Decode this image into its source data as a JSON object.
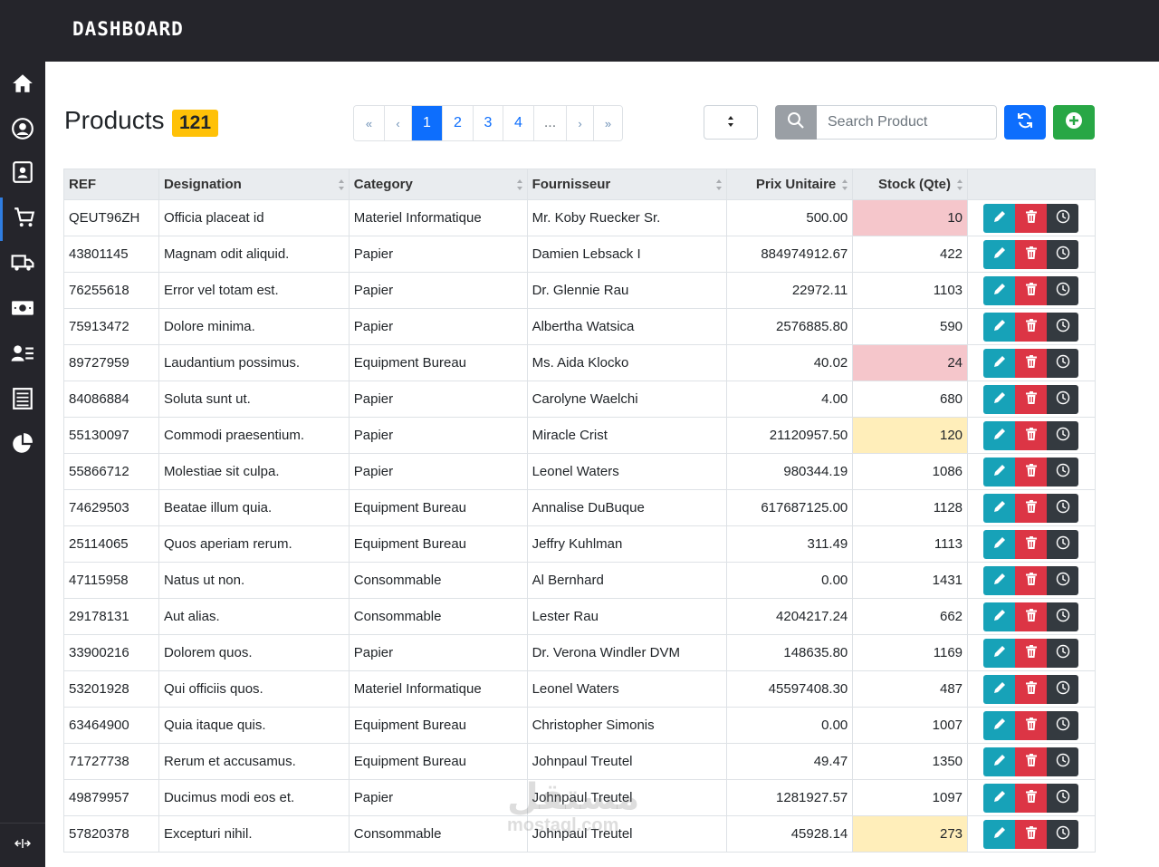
{
  "header": {
    "brand": "DASHBOARD"
  },
  "sidebar": {
    "items": [
      {
        "icon": "home-icon",
        "active": false
      },
      {
        "icon": "user-circle-icon",
        "active": false
      },
      {
        "icon": "contact-card-icon",
        "active": false
      },
      {
        "icon": "cart-icon",
        "active": true
      },
      {
        "icon": "truck-icon",
        "active": false
      },
      {
        "icon": "money-icon",
        "active": false
      },
      {
        "icon": "user-list-icon",
        "active": false
      },
      {
        "icon": "document-icon",
        "active": false
      },
      {
        "icon": "pie-chart-icon",
        "active": false
      }
    ],
    "collapse_icon": "collapse-icon"
  },
  "page": {
    "title": "Products",
    "count": "121"
  },
  "pagination": {
    "first": "«",
    "prev": "‹",
    "pages": [
      "1",
      "2",
      "3",
      "4"
    ],
    "active": "1",
    "ellipsis": "...",
    "next": "›",
    "last": "»"
  },
  "toolbar": {
    "search_placeholder": "Search Product",
    "search_icon": "search-icon",
    "refresh_icon": "refresh-icon",
    "add_icon": "plus-circle-icon"
  },
  "table": {
    "columns": [
      "REF",
      "Designation",
      "Category",
      "Fournisseur",
      "Prix Unitaire",
      "Stock (Qte)"
    ],
    "rows": [
      {
        "ref": "QEUT96ZH",
        "designation": "Officia placeat id",
        "category": "Materiel Informatique",
        "fournisseur": "Mr. Koby Ruecker Sr.",
        "prix": "500.00",
        "stock": "10",
        "stock_status": "danger"
      },
      {
        "ref": "43801145",
        "designation": "Magnam odit aliquid.",
        "category": "Papier",
        "fournisseur": "Damien Lebsack I",
        "prix": "884974912.67",
        "stock": "422",
        "stock_status": "ok"
      },
      {
        "ref": "76255618",
        "designation": "Error vel totam est.",
        "category": "Papier",
        "fournisseur": "Dr. Glennie Rau",
        "prix": "22972.11",
        "stock": "1103",
        "stock_status": "ok"
      },
      {
        "ref": "75913472",
        "designation": "Dolore minima.",
        "category": "Papier",
        "fournisseur": "Albertha Watsica",
        "prix": "2576885.80",
        "stock": "590",
        "stock_status": "ok"
      },
      {
        "ref": "89727959",
        "designation": "Laudantium possimus.",
        "category": "Equipment Bureau",
        "fournisseur": "Ms. Aida Klocko",
        "prix": "40.02",
        "stock": "24",
        "stock_status": "danger"
      },
      {
        "ref": "84086884",
        "designation": "Soluta sunt ut.",
        "category": "Papier",
        "fournisseur": "Carolyne Waelchi",
        "prix": "4.00",
        "stock": "680",
        "stock_status": "ok"
      },
      {
        "ref": "55130097",
        "designation": "Commodi praesentium.",
        "category": "Papier",
        "fournisseur": "Miracle Crist",
        "prix": "21120957.50",
        "stock": "120",
        "stock_status": "warn"
      },
      {
        "ref": "55866712",
        "designation": "Molestiae sit culpa.",
        "category": "Papier",
        "fournisseur": "Leonel Waters",
        "prix": "980344.19",
        "stock": "1086",
        "stock_status": "ok"
      },
      {
        "ref": "74629503",
        "designation": "Beatae illum quia.",
        "category": "Equipment Bureau",
        "fournisseur": "Annalise DuBuque",
        "prix": "617687125.00",
        "stock": "1128",
        "stock_status": "ok"
      },
      {
        "ref": "25114065",
        "designation": "Quos aperiam rerum.",
        "category": "Equipment Bureau",
        "fournisseur": "Jeffry Kuhlman",
        "prix": "311.49",
        "stock": "1113",
        "stock_status": "ok"
      },
      {
        "ref": "47115958",
        "designation": "Natus ut non.",
        "category": "Consommable",
        "fournisseur": "Al Bernhard",
        "prix": "0.00",
        "stock": "1431",
        "stock_status": "ok"
      },
      {
        "ref": "29178131",
        "designation": "Aut alias.",
        "category": "Consommable",
        "fournisseur": "Lester Rau",
        "prix": "4204217.24",
        "stock": "662",
        "stock_status": "ok"
      },
      {
        "ref": "33900216",
        "designation": "Dolorem quos.",
        "category": "Papier",
        "fournisseur": "Dr. Verona Windler DVM",
        "prix": "148635.80",
        "stock": "1169",
        "stock_status": "ok"
      },
      {
        "ref": "53201928",
        "designation": "Qui officiis quos.",
        "category": "Materiel Informatique",
        "fournisseur": "Leonel Waters",
        "prix": "45597408.30",
        "stock": "487",
        "stock_status": "ok"
      },
      {
        "ref": "63464900",
        "designation": "Quia itaque quis.",
        "category": "Equipment Bureau",
        "fournisseur": "Christopher Simonis",
        "prix": "0.00",
        "stock": "1007",
        "stock_status": "ok"
      },
      {
        "ref": "71727738",
        "designation": "Rerum et accusamus.",
        "category": "Equipment Bureau",
        "fournisseur": "Johnpaul Treutel",
        "prix": "49.47",
        "stock": "1350",
        "stock_status": "ok"
      },
      {
        "ref": "49879957",
        "designation": "Ducimus modi eos et.",
        "category": "Papier",
        "fournisseur": "Johnpaul Treutel",
        "prix": "1281927.57",
        "stock": "1097",
        "stock_status": "ok"
      },
      {
        "ref": "57820378",
        "designation": "Excepturi nihil.",
        "category": "Consommable",
        "fournisseur": "Johnpaul Treutel",
        "prix": "45928.14",
        "stock": "273",
        "stock_status": "warn"
      }
    ]
  },
  "watermark": {
    "line1": "مستقل",
    "line2": "mostaql.com"
  },
  "colors": {
    "topbar": "#25252b",
    "accent": "#0d6efd",
    "badge": "#ffc107",
    "danger_row": "#f5c6cb",
    "warn_row": "#ffeeba",
    "edit": "#17a2b8",
    "delete": "#dc3545",
    "history": "#343a40",
    "add": "#28a745"
  }
}
